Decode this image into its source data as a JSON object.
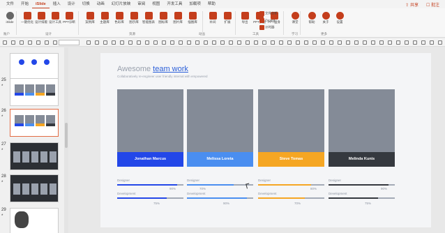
{
  "menubar": {
    "items": [
      "文件",
      "开始",
      "iSlide",
      "插入",
      "设计",
      "切换",
      "动画",
      "幻灯片放映",
      "审阅",
      "视图",
      "开发工具",
      "加载项",
      "帮助"
    ],
    "active_index": 2,
    "share": "共享",
    "annotate": "批注"
  },
  "ribbon": {
    "buttons": [
      {
        "label": "iSlide"
      },
      {
        "label": "一键优化"
      },
      {
        "label": "设计排版"
      },
      {
        "label": "设计工具"
      },
      {
        "label": "PPT诊断"
      },
      {
        "label": "案例库"
      },
      {
        "label": "主题库"
      },
      {
        "label": "色彩库"
      },
      {
        "label": "图示库"
      },
      {
        "label": "智能图表"
      },
      {
        "label": "图标库"
      },
      {
        "label": "图片库"
      },
      {
        "label": "插图库"
      },
      {
        "label": "补间"
      },
      {
        "label": "扩展"
      },
      {
        "label": "导出"
      },
      {
        "label": "PPT拼图"
      },
      {
        "label": "PPT瘦身"
      },
      {
        "label": "课堂"
      },
      {
        "label": "帮助"
      },
      {
        "label": "关于"
      },
      {
        "label": "设置"
      }
    ],
    "small_items": [
      "文件分析",
      "ZoomIt",
      "计时器"
    ],
    "groups": [
      "账户",
      "设计",
      "资源",
      "动画",
      "工具",
      "学习",
      "更多"
    ]
  },
  "thumbnails": {
    "numbers": [
      "25",
      "26",
      "27",
      "28",
      "29"
    ],
    "selected": "26"
  },
  "slide": {
    "title_pre": "Awesome ",
    "title_link": "team work",
    "subtitle": "Collaboratively re-engineer user friendly internal with empowered",
    "members": [
      {
        "name": "Jonathan Marcus",
        "color": "#2347e8",
        "designer": 0.9,
        "designer_pct": "90%",
        "dev": 0.75,
        "dev_pct": "75%"
      },
      {
        "name": "Melissa Loreta",
        "color": "#4a8ef0",
        "designer": 0.7,
        "designer_pct": "70%",
        "dev": 0.9,
        "dev_pct": "90%"
      },
      {
        "name": "Steve Tomas",
        "color": "#f5a623",
        "designer": 0.8,
        "designer_pct": "80%",
        "dev": 0.7,
        "dev_pct": "70%"
      },
      {
        "name": "Melinda Kunis",
        "color": "#35393f",
        "designer": 0.9,
        "designer_pct": "90%",
        "dev": 0.75,
        "dev_pct": "75%"
      }
    ],
    "designer_label": "Designer",
    "dev_label": "Development"
  }
}
